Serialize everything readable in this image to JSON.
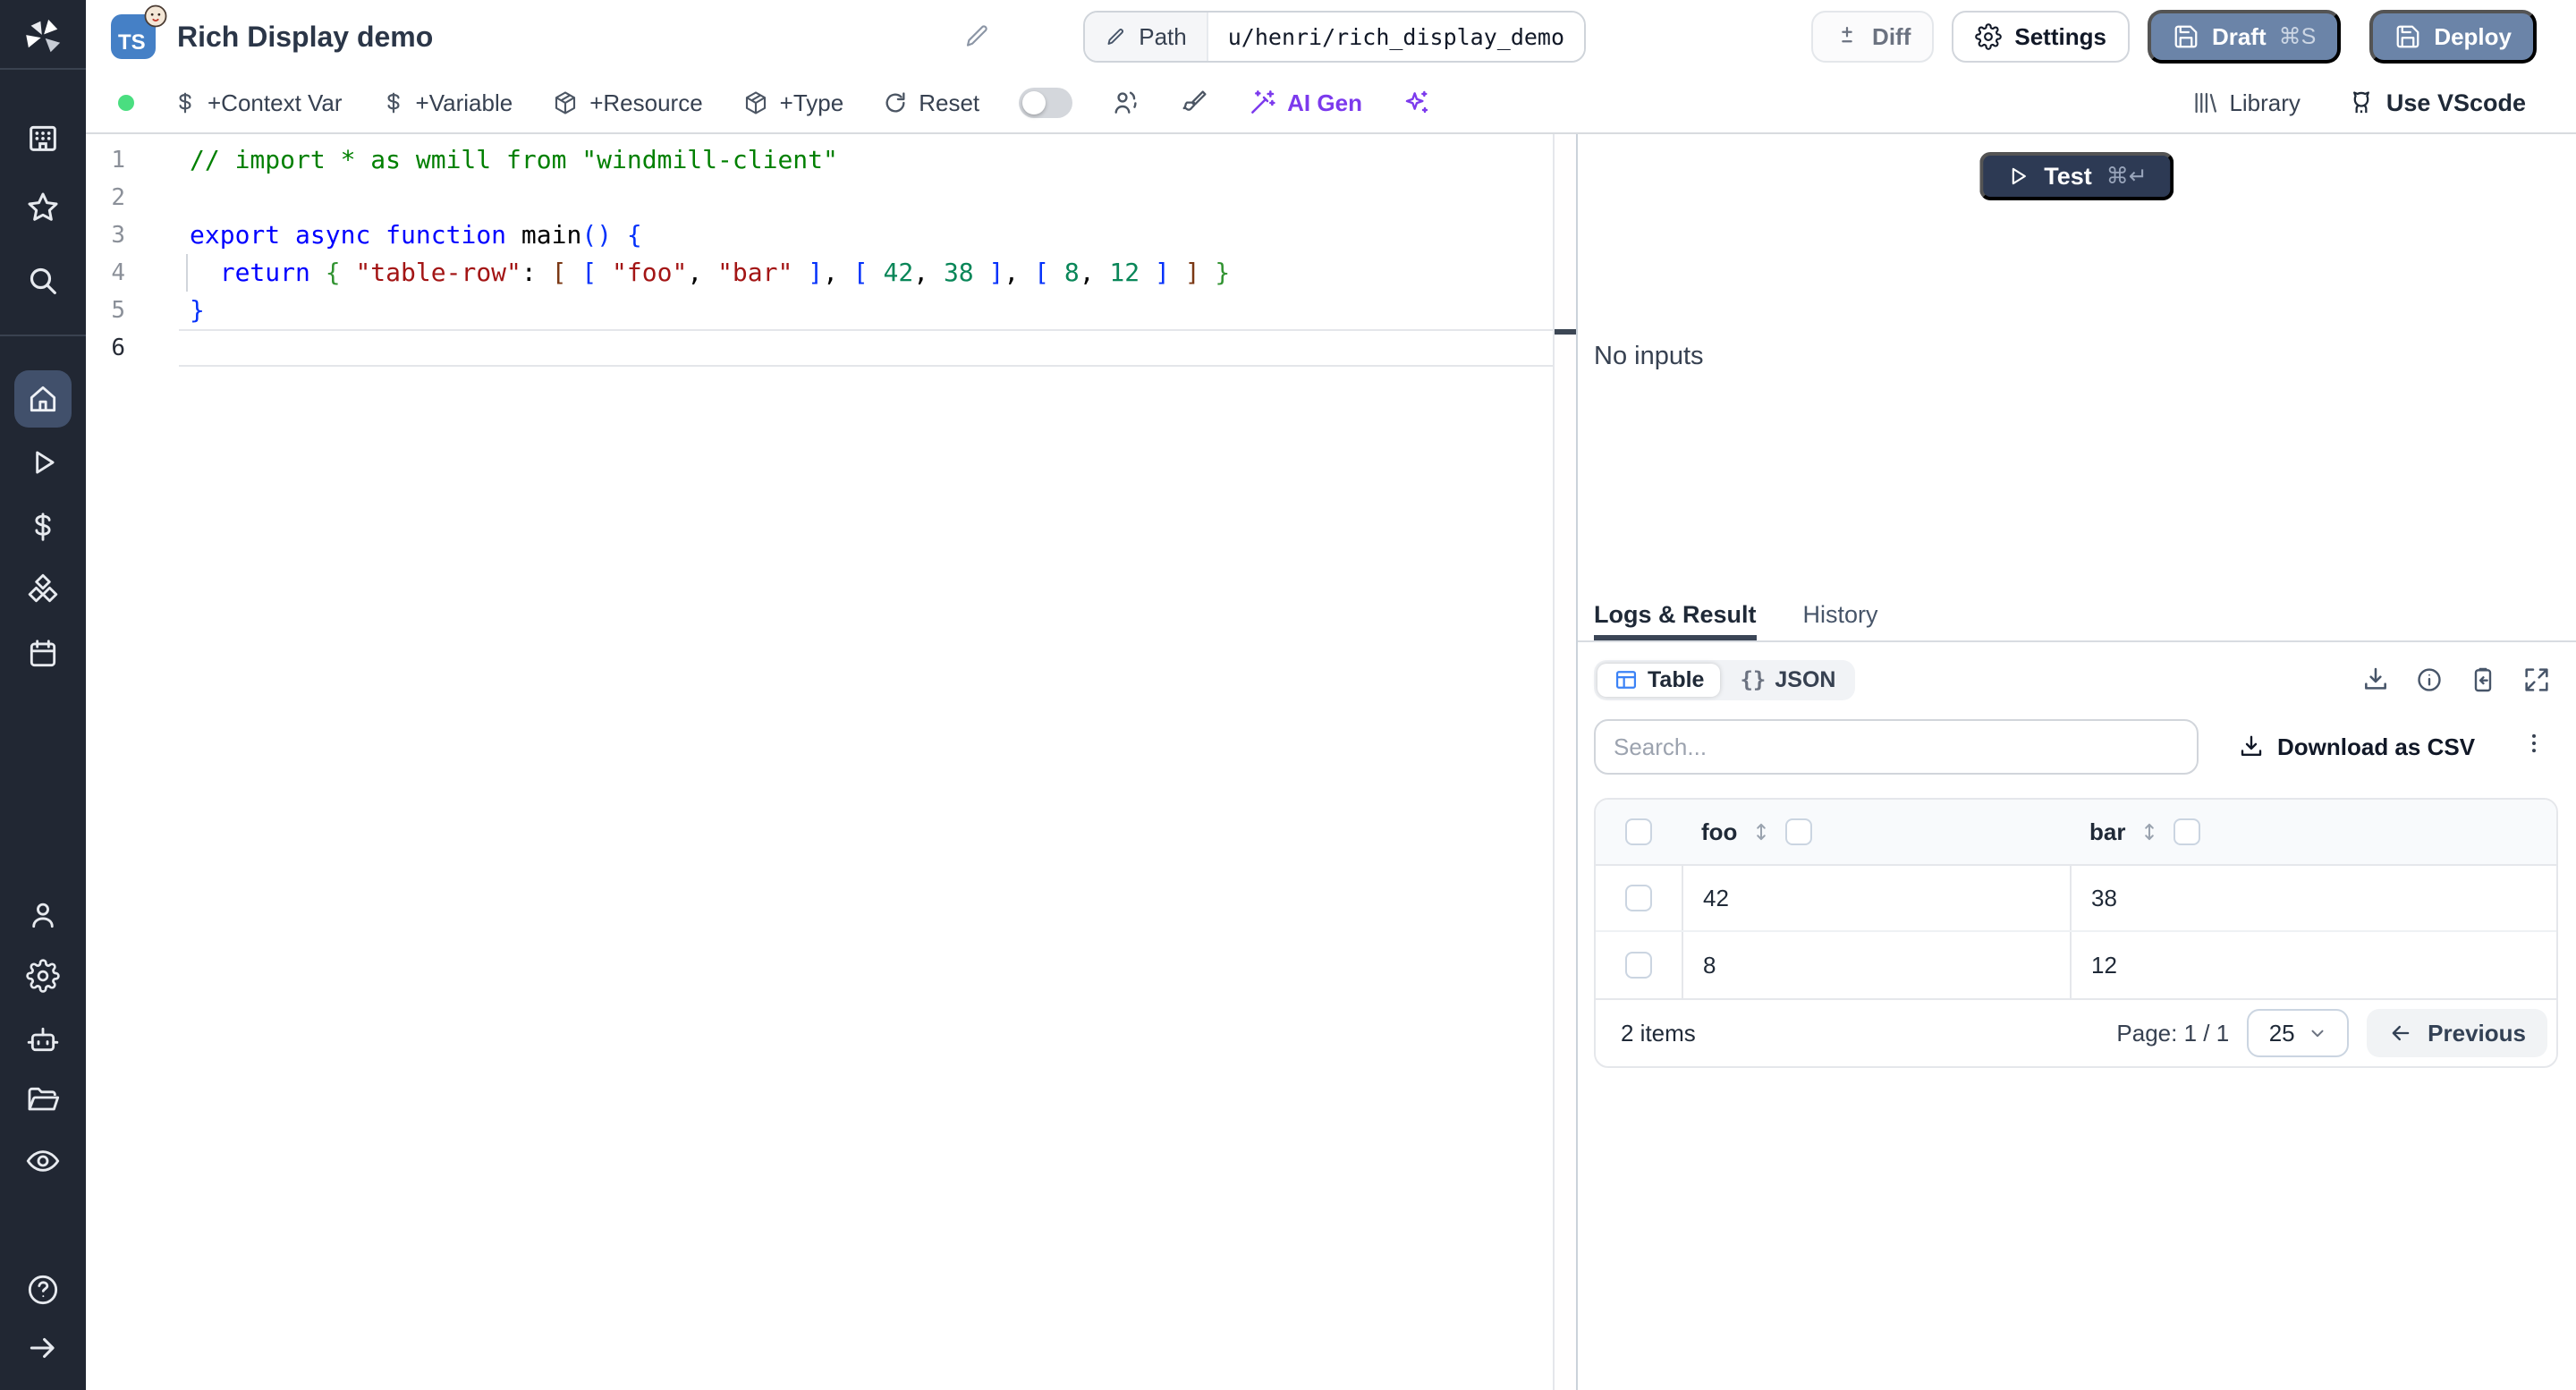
{
  "header": {
    "title": "Rich Display demo",
    "language_badge": "TS",
    "path_label": "Path",
    "path_value": "u/henri/rich_display_demo",
    "diff_label": "Diff",
    "settings_label": "Settings",
    "draft_label": "Draft",
    "draft_shortcut": "⌘S",
    "deploy_label": "Deploy"
  },
  "toolbar": {
    "context_var": "+Context Var",
    "variable": "+Variable",
    "resource": "+Resource",
    "type": "+Type",
    "reset": "Reset",
    "ai_gen": "AI Gen",
    "library": "Library",
    "vscode": "Use VScode"
  },
  "sidebar_icons": [
    "windmill-logo",
    "workspace-building",
    "favorites-star",
    "search",
    "home",
    "runs-play",
    "variables-dollar",
    "resources-cubes",
    "schedules-calendar",
    "user",
    "settings-gear",
    "workers-robot",
    "folders",
    "audit-logs-eye",
    "help",
    "expand-arrow"
  ],
  "editor": {
    "active_line": 6,
    "line_numbers": [
      "1",
      "2",
      "3",
      "4",
      "5",
      "6"
    ],
    "token_colors": {
      "comment": "#008000",
      "keyword": "#0000ff",
      "string": "#a31515",
      "number": "#098658",
      "plain": "#000000",
      "func": "#000000",
      "b1": "#0431fa",
      "b2": "#319331",
      "b3": "#7b3814"
    },
    "lines": [
      [
        {
          "t": "// import * as wmill from \"windmill-client\"",
          "c": "comment"
        }
      ],
      [],
      [
        {
          "t": "export",
          "c": "keyword"
        },
        {
          "t": " ",
          "c": "plain"
        },
        {
          "t": "async",
          "c": "keyword"
        },
        {
          "t": " ",
          "c": "plain"
        },
        {
          "t": "function",
          "c": "keyword"
        },
        {
          "t": " ",
          "c": "plain"
        },
        {
          "t": "main",
          "c": "func"
        },
        {
          "t": "(",
          "c": "b1"
        },
        {
          "t": ")",
          "c": "b1"
        },
        {
          "t": " ",
          "c": "plain"
        },
        {
          "t": "{",
          "c": "b1"
        }
      ],
      [
        {
          "t": "  ",
          "c": "plain"
        },
        {
          "t": "return",
          "c": "keyword"
        },
        {
          "t": " ",
          "c": "plain"
        },
        {
          "t": "{",
          "c": "b2"
        },
        {
          "t": " ",
          "c": "plain"
        },
        {
          "t": "\"table-row\"",
          "c": "string"
        },
        {
          "t": ": ",
          "c": "plain"
        },
        {
          "t": "[",
          "c": "b3"
        },
        {
          "t": " ",
          "c": "plain"
        },
        {
          "t": "[",
          "c": "b1"
        },
        {
          "t": " ",
          "c": "plain"
        },
        {
          "t": "\"foo\"",
          "c": "string"
        },
        {
          "t": ", ",
          "c": "plain"
        },
        {
          "t": "\"bar\"",
          "c": "string"
        },
        {
          "t": " ",
          "c": "plain"
        },
        {
          "t": "]",
          "c": "b1"
        },
        {
          "t": ", ",
          "c": "plain"
        },
        {
          "t": "[",
          "c": "b1"
        },
        {
          "t": " ",
          "c": "plain"
        },
        {
          "t": "42",
          "c": "number"
        },
        {
          "t": ", ",
          "c": "plain"
        },
        {
          "t": "38",
          "c": "number"
        },
        {
          "t": " ",
          "c": "plain"
        },
        {
          "t": "]",
          "c": "b1"
        },
        {
          "t": ", ",
          "c": "plain"
        },
        {
          "t": "[",
          "c": "b1"
        },
        {
          "t": " ",
          "c": "plain"
        },
        {
          "t": "8",
          "c": "number"
        },
        {
          "t": ", ",
          "c": "plain"
        },
        {
          "t": "12",
          "c": "number"
        },
        {
          "t": " ",
          "c": "plain"
        },
        {
          "t": "]",
          "c": "b1"
        },
        {
          "t": " ",
          "c": "plain"
        },
        {
          "t": "]",
          "c": "b3"
        },
        {
          "t": " ",
          "c": "plain"
        },
        {
          "t": "}",
          "c": "b2"
        }
      ],
      [
        {
          "t": "}",
          "c": "b1"
        }
      ],
      []
    ]
  },
  "run": {
    "test_label": "Test",
    "test_shortcut": "⌘↵",
    "no_inputs": "No inputs"
  },
  "result_panel": {
    "tabs": {
      "logs": "Logs & Result",
      "history": "History"
    },
    "active_tab": "Logs & Result",
    "view_toggle": {
      "table": "Table",
      "json": "JSON",
      "json_glyph": "{}"
    },
    "search_placeholder": "Search...",
    "download_csv": "Download as CSV",
    "table": {
      "columns": [
        "foo",
        "bar"
      ],
      "rows": [
        [
          "42",
          "38"
        ],
        [
          "8",
          "12"
        ]
      ]
    },
    "footer": {
      "items": "2 items",
      "page": "Page: 1 / 1",
      "page_size": "25",
      "previous": "Previous"
    }
  },
  "colors": {
    "primary_button": "#6b84a8",
    "test_button": "#2d3a54",
    "ai_accent": "#7c3aed",
    "sidebar_bg": "#212733",
    "active_nav_bg": "#41506b",
    "table_icon_blue": "#3b82f6",
    "status_green": "#4ade80"
  }
}
